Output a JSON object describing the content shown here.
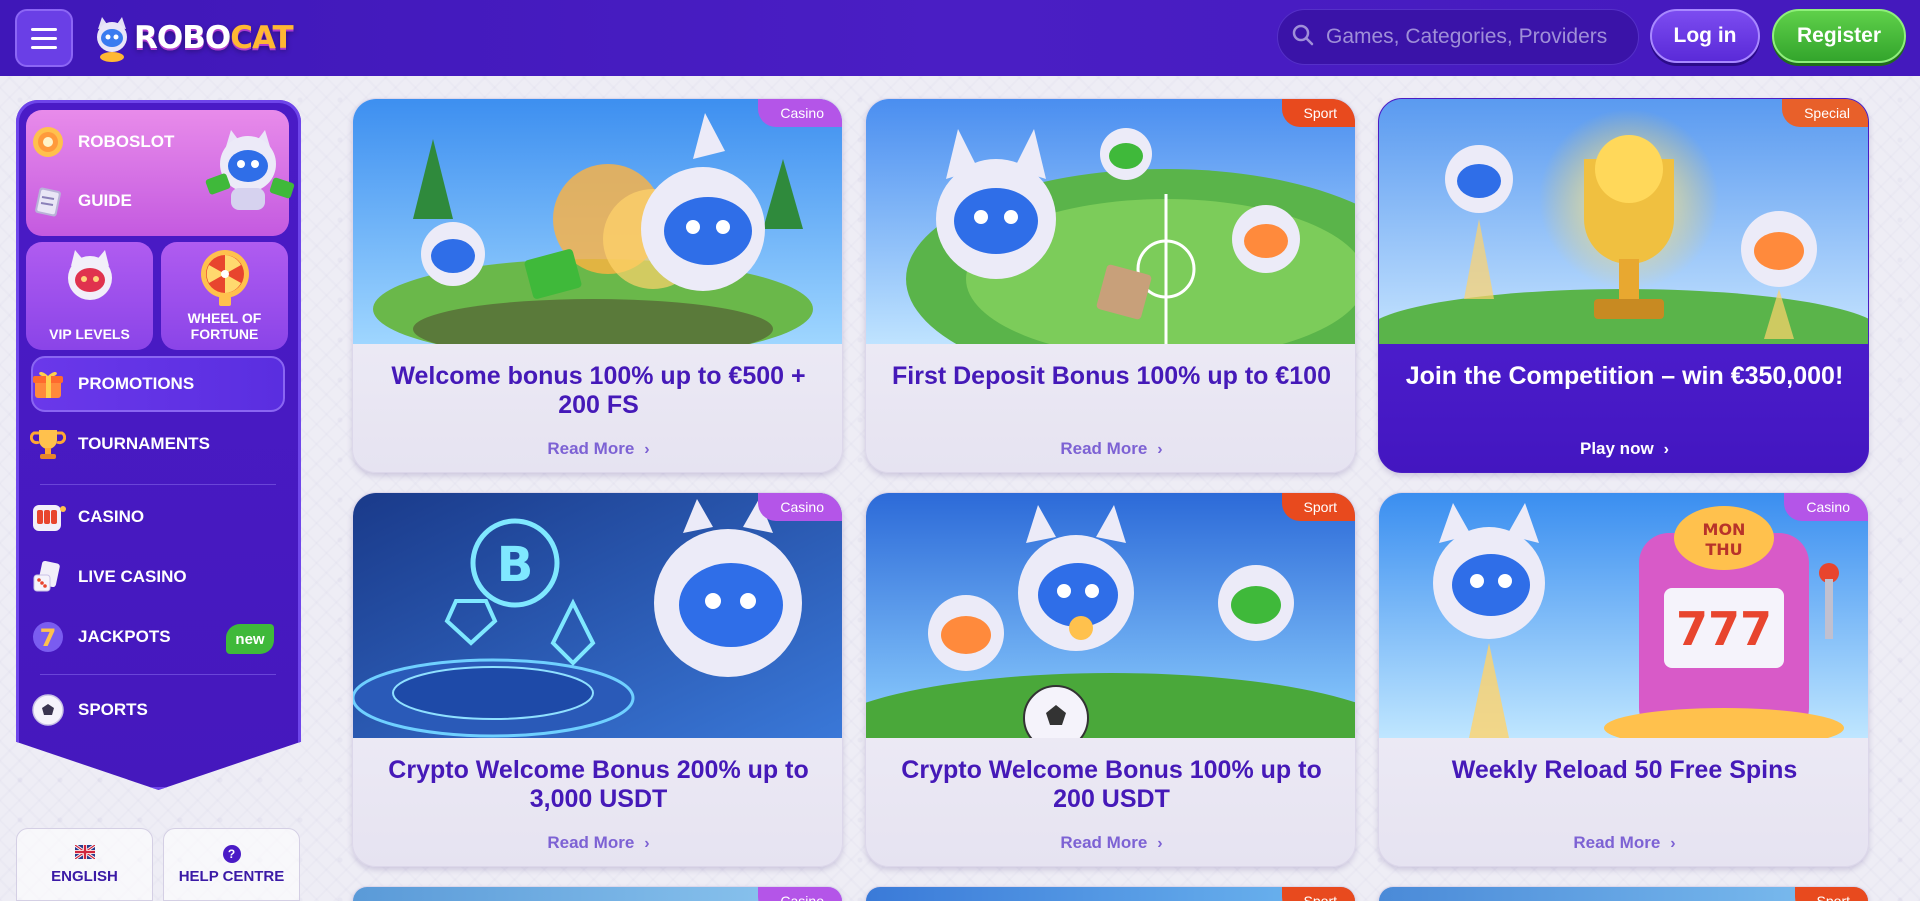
{
  "header": {
    "logo_text_a": "ROBO",
    "logo_text_b": "CAT",
    "search_placeholder": "Games, Categories, Providers",
    "login_label": "Log in",
    "register_label": "Register"
  },
  "sidebar": {
    "roboslot": "ROBOSLOT",
    "guide": "GUIDE",
    "vip_levels": "VIP LEVELS",
    "wheel_line1": "WHEEL OF",
    "wheel_line2": "FORTUNE",
    "promotions": "PROMOTIONS",
    "tournaments": "TOURNAMENTS",
    "casino": "CASINO",
    "live_casino": "LIVE CASINO",
    "jackpots": "JACKPOTS",
    "new_badge": "new",
    "sports": "SPORTS"
  },
  "footer": {
    "language": "ENGLISH",
    "help": "HELP CENTRE",
    "help_icon_glyph": "?"
  },
  "cards": [
    {
      "tag": "Casino",
      "title": "Welcome bonus 100% up to €500 + 200 FS",
      "link": "Read More"
    },
    {
      "tag": "Sport",
      "title": "First Deposit Bonus 100% up to €100",
      "link": "Read More"
    },
    {
      "tag": "Special",
      "title": "Join the Competition – win €350,000!",
      "link": "Play now"
    },
    {
      "tag": "Casino",
      "title": "Crypto Welcome Bonus 200% up to 3,000 USDT",
      "link": "Read More"
    },
    {
      "tag": "Sport",
      "title": "Crypto Welcome Bonus 100% up to 200 USDT",
      "link": "Read More"
    },
    {
      "tag": "Casino",
      "title": "Weekly Reload 50 Free Spins",
      "link": "Read More"
    },
    {
      "tag": "Casino"
    },
    {
      "tag": "Sport"
    },
    {
      "tag": "Sport"
    }
  ],
  "chevron_glyph": "›",
  "colors": {
    "header_bg": "#4a1ec4",
    "sidebar_bg": "#4518bd",
    "title_purple": "#4519b8",
    "casino_tag": "#b455e8",
    "sport_tag": "#e84a1e",
    "register_green": "#33a52c"
  }
}
